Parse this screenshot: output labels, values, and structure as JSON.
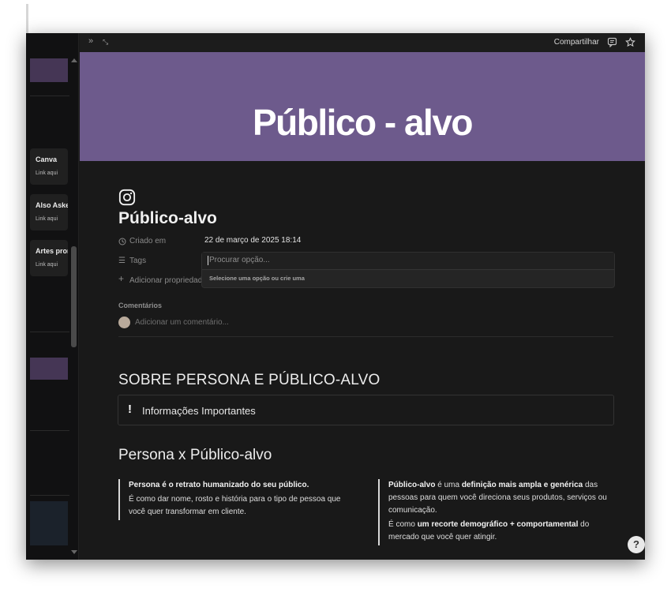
{
  "topbar": {
    "share_label": "Compartilhar",
    "expand_icon": "double-chevron-right-icon",
    "resize_icon": "expand-diagonal-icon",
    "comment_icon": "comment-icon",
    "star_icon": "star-icon"
  },
  "sidebar": {
    "cards": [
      {
        "title": "Canva",
        "sub": "Link aqui"
      },
      {
        "title": "Also Asked",
        "sub": "Link aqui"
      },
      {
        "title": "Artes prontas",
        "sub": "Link aqui"
      }
    ]
  },
  "cover": {
    "title": "Público - alvo",
    "color": "#6d5a8c"
  },
  "page": {
    "icon": "instagram-icon",
    "title": "Público-alvo",
    "properties": {
      "created_label": "Criado em",
      "created_value": "22 de março de 2025 18:14",
      "tags_label": "Tags",
      "add_property_label": "Adicionar propriedade"
    },
    "tag_dropdown": {
      "placeholder": "Procurar opção...",
      "hint": "Selecione uma opção ou crie uma"
    },
    "comments": {
      "label": "Comentários",
      "placeholder": "Adicionar um comentário..."
    }
  },
  "content": {
    "heading_sobre": "SOBRE PERSONA E PÚBLICO-ALVO",
    "callout": {
      "icon": "!",
      "text": "Informações Importantes"
    },
    "heading_persona": "Persona x Público-alvo",
    "left_quote": {
      "line1_bold": "Persona é o retrato humanizado do seu público.",
      "line2": "É como dar nome, rosto e história para o tipo de pessoa que você quer transformar em cliente."
    },
    "right_quote": {
      "p1_b1": "Público-alvo",
      "p1_t1": " é uma ",
      "p1_b2": "definição mais ampla e genérica",
      "p1_t2": " das pessoas para quem você direciona seus produtos, serviços ou comunicação.",
      "p2_t1": "É como ",
      "p2_b1": "um recorte demográfico + comportamental",
      "p2_t2": " do mercado que você quer atingir."
    }
  },
  "help": {
    "label": "?",
    "icon": "help-icon"
  }
}
